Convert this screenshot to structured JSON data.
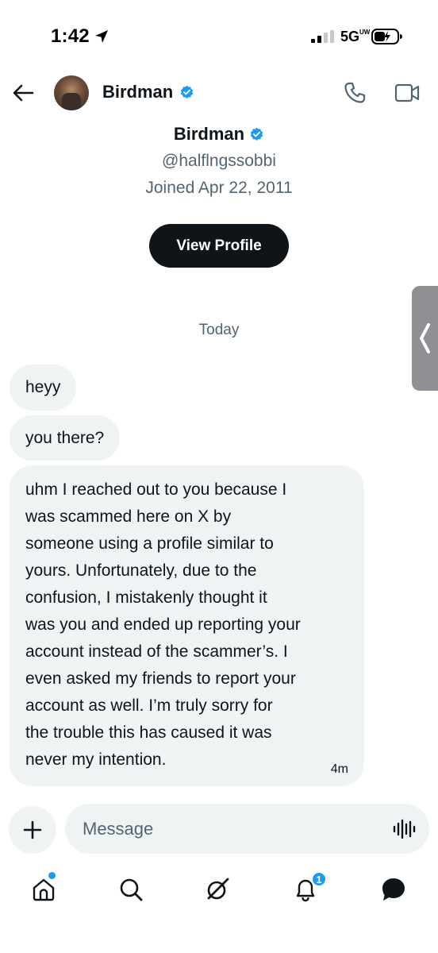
{
  "status_bar": {
    "time": "1:42",
    "network": "5G",
    "network_suffix": "UW"
  },
  "header": {
    "name": "Birdman",
    "back_icon": "back-arrow-icon",
    "phone_icon": "phone-icon",
    "video_icon": "video-icon"
  },
  "profile": {
    "name": "Birdman",
    "handle": "@halflngssobbi",
    "joined": "Joined Apr 22, 2011",
    "view_profile_label": "View Profile"
  },
  "conversation": {
    "date_separator": "Today",
    "messages": [
      {
        "text": "heyy"
      },
      {
        "text": "you there?"
      },
      {
        "text": "uhm I reached out to you because I\nwas scammed here on X by\nsomeone using a profile similar to\nyours. Unfortunately, due to the\nconfusion, I mistakenly thought it\nwas you and ended up reporting your\naccount instead of the scammer’s. I\neven asked my friends to report your\naccount as well. I’m truly sorry for\nthe trouble this has caused it was\nnever my intention.",
        "time": "4m"
      }
    ]
  },
  "composer": {
    "placeholder": "Message"
  },
  "bottom_nav": {
    "items": [
      "home-icon",
      "search-icon",
      "grok-icon",
      "notifications-icon",
      "messages-icon"
    ],
    "notification_count": "1"
  },
  "colors": {
    "accent": "#1d9bf0",
    "bubble": "#eff3f4",
    "text": "#0f1419",
    "secondary": "#536471"
  }
}
